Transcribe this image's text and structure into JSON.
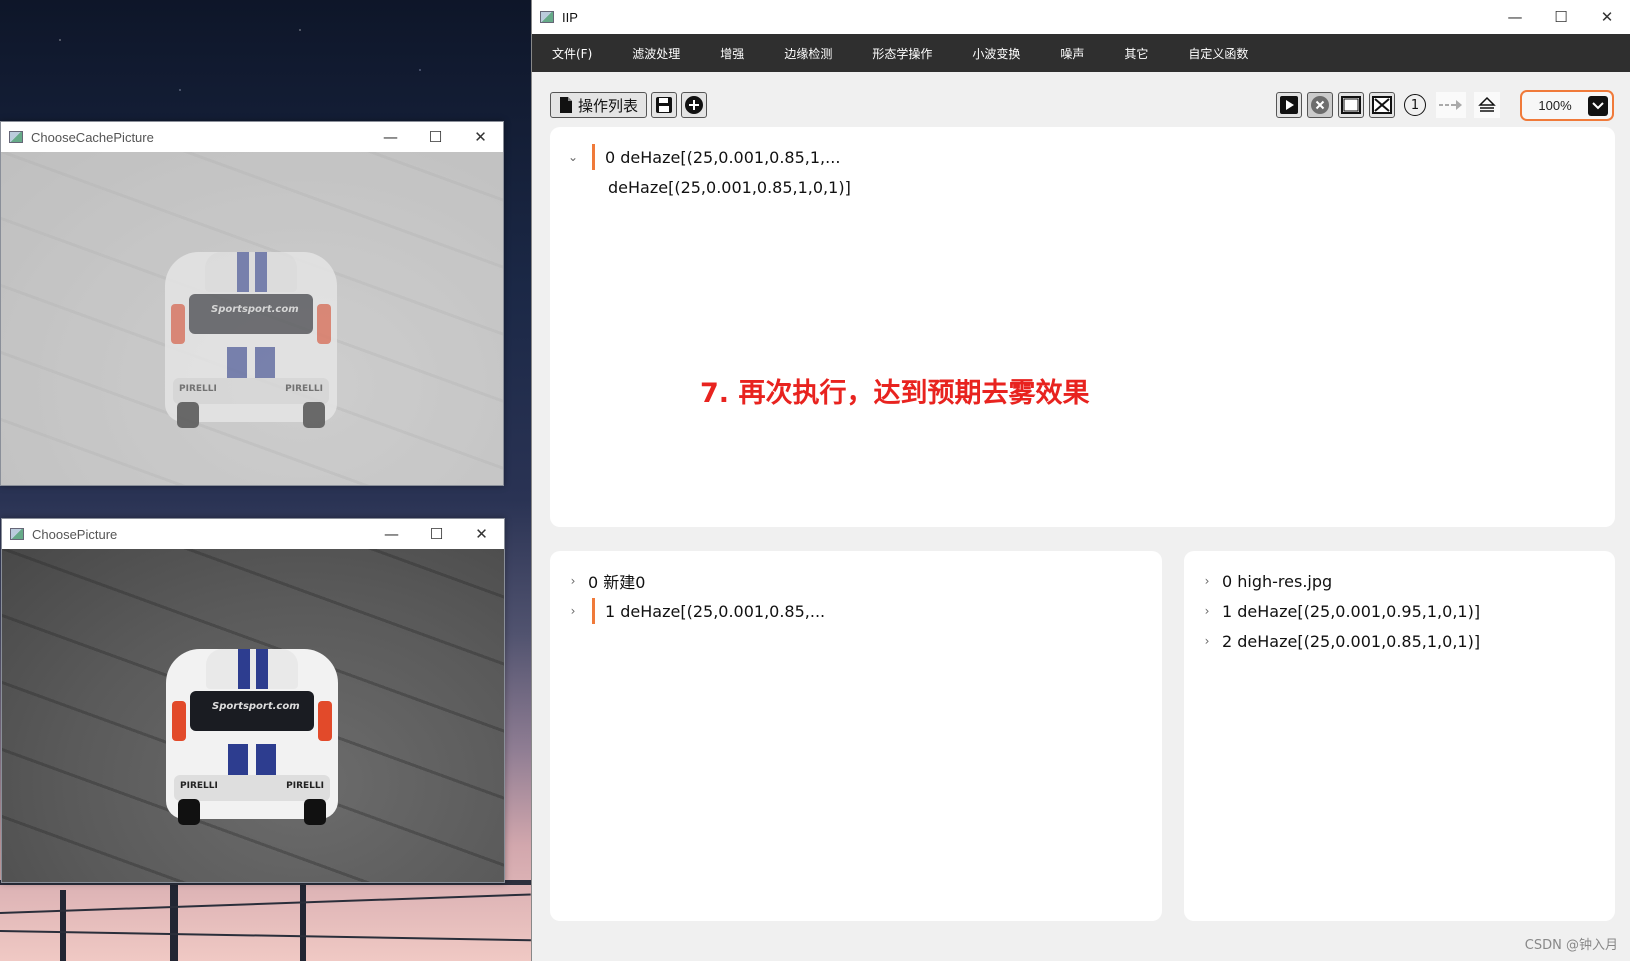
{
  "cache_window": {
    "title": "ChooseCachePicture",
    "controls": {
      "minimize": "—",
      "maximize": "☐",
      "close": "✕"
    },
    "car_text": "Sportsport.com",
    "bumper_text_left": "PIRELLI",
    "bumper_text_right": "PIRELLI"
  },
  "picture_window": {
    "title": "ChoosePicture",
    "controls": {
      "minimize": "—",
      "maximize": "☐",
      "close": "✕"
    },
    "car_text": "Sportsport.com",
    "bumper_text_left": "PIRELLI",
    "bumper_text_right": "PIRELLI"
  },
  "main_window": {
    "title": "IIP",
    "controls": {
      "minimize": "—",
      "maximize": "☐",
      "close": "✕"
    }
  },
  "menu": [
    "文件(F)",
    "滤波处理",
    "增强",
    "边缘检测",
    "形态学操作",
    "小波变换",
    "噪声",
    "其它",
    "自定义函数"
  ],
  "toolbar": {
    "op_list_label": "操作列表",
    "zoom": "100%",
    "step_number": "1"
  },
  "operations_panel": {
    "item_label": "0 deHaze[(25,0.001,0.85,1,...",
    "child_label": "deHaze[(25,0.001,0.85,1,0,1)]"
  },
  "annotation": "7. 再次执行，达到预期去雾效果",
  "history_panel": {
    "items": [
      "0 新建0",
      "1 deHaze[(25,0.001,0.85,..."
    ]
  },
  "images_panel": {
    "items": [
      "0 high-res.jpg",
      "1 deHaze[(25,0.001,0.95,1,0,1)]",
      "2 deHaze[(25,0.001,0.85,1,0,1)]"
    ]
  },
  "watermark": "CSDN @钟入月",
  "colors": {
    "accent": "#f07a3a",
    "annotation": "#e8231f",
    "menubar": "#2f2f2f"
  }
}
